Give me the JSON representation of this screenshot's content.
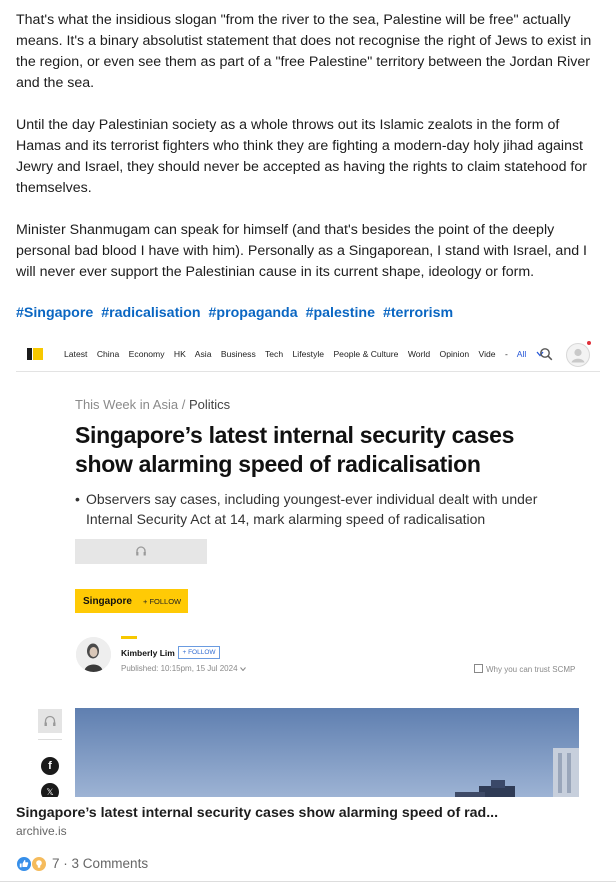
{
  "post": {
    "paragraphs": [
      "That's what the insidious slogan \"from the river to the sea, Palestine will be free\" actually means. It's a binary absolutist statement that does not recognise the right of Jews to exist in the region, or even see them as part of a \"free Palestine\" territory between the Jordan River and the sea.",
      "Until the day Palestinian society as a whole throws out its Islamic zealots in the form of Hamas and its terrorist fighters who think they are fighting a modern-day holy jihad against Jewry and Israel, they should never be accepted as having the rights to claim statehood for themselves.",
      "Minister Shanmugam can speak for himself (and that's besides the point of the deeply personal bad blood I have with him). Personally as a Singaporean, I stand with Israel, and I will never ever support the Palestinian cause in its current shape, ideology or form."
    ],
    "hashtags": [
      "#Singapore",
      "#radicalisation",
      "#propaganda",
      "#palestine",
      "#terrorism"
    ]
  },
  "embed": {
    "nav": {
      "items": [
        "Latest",
        "China",
        "Economy",
        "HK",
        "Asia",
        "Business",
        "Tech",
        "Lifestyle",
        "People & Culture",
        "World",
        "Opinion",
        "Vide"
      ],
      "separator": "-",
      "all_label": "All"
    },
    "breadcrumb": {
      "series": "This Week in Asia",
      "divider": "/",
      "section": "Politics"
    },
    "headline": "Singapore’s latest internal security cases show alarming speed of radicalisation",
    "summary": "Observers say cases, including youngest-ever individual dealt with under Internal Security Act at 14, mark alarming speed of radicalisation",
    "summary_bullet": "•",
    "topic": {
      "label": "Singapore",
      "follow": "+ FOLLOW"
    },
    "author": {
      "name": "Kimberly Lim",
      "follow": "+ FOLLOW",
      "published": "Published: 10:15pm, 15 Jul 2024",
      "trust_link": "Why you can trust SCMP"
    },
    "social_glyphs": {
      "facebook": "f",
      "x": "𝕏"
    }
  },
  "link_card": {
    "title": "Singapore’s latest internal security cases show alarming speed of rad...",
    "domain": "archive.is"
  },
  "social": {
    "reactions_count": "7",
    "separator": "·",
    "comments": "3 Comments"
  },
  "colors": {
    "hashtag": "#0a66c2",
    "scmp_yellow": "#ffca05",
    "like_blue": "#378fe9"
  },
  "icons": [
    "scmp-logo",
    "search-icon",
    "user-avatar-icon",
    "headphones-icon",
    "facebook-icon",
    "x-icon",
    "like-reaction-icon",
    "insightful-reaction-icon"
  ]
}
